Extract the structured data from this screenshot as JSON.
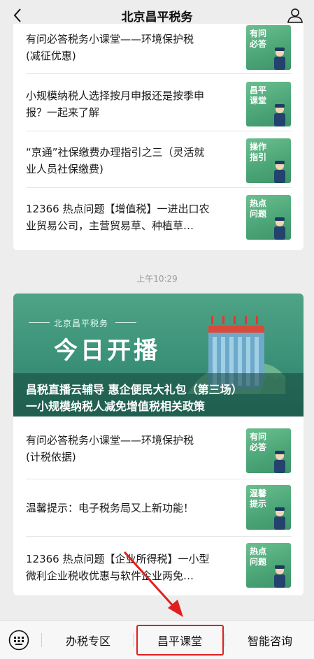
{
  "header": {
    "title": "北京昌平税务",
    "back_icon": "chevron-left-icon",
    "profile_icon": "person-icon"
  },
  "feed1": [
    {
      "lines": [
        "有问必答税务小课堂——环境保护税",
        "(减征优惠)"
      ],
      "thumb_tag": "有问必答"
    },
    {
      "lines": [
        "小规模纳税人选择按月申报还是按季申",
        "报？一起来了解"
      ],
      "thumb_tag": "昌平课堂"
    },
    {
      "lines": [
        "“京通”社保缴费办理指引之三（灵活就",
        "业人员社保缴费)"
      ],
      "thumb_tag": "操作指引"
    },
    {
      "lines": [
        "12366 热点问题【增值税】一进出口农",
        "业贸易公司，主营贸易草、种植草…"
      ],
      "thumb_tag": "热点问题"
    }
  ],
  "timestamp": "上午10:29",
  "banner": {
    "brand": "北京昌平税务",
    "headline": "今日开播",
    "caption_line1": "昌税直播云辅导 惠企便民大礼包（第三场）",
    "caption_line2": "一小规模纳税人减免增值税相关政策"
  },
  "feed2": [
    {
      "lines": [
        "有问必答税务小课堂——环境保护税",
        "(计税依据)"
      ],
      "thumb_tag": "有问必答"
    },
    {
      "lines": [
        "温馨提示：电子税务局又上新功能！"
      ],
      "thumb_tag": "温馨提示"
    },
    {
      "lines": [
        "12366 热点问题【企业所得税】一小型",
        "微利企业税收优惠与软件企业两免…"
      ],
      "thumb_tag": "热点问题"
    }
  ],
  "tabbar": {
    "keyboard_icon": "keyboard-icon",
    "tabs": [
      "办税专区",
      "昌平课堂",
      "智能咨询"
    ]
  },
  "colors": {
    "highlight": "#e02020",
    "thumb_green": "#4aa476",
    "banner_green": "#3a9177"
  }
}
